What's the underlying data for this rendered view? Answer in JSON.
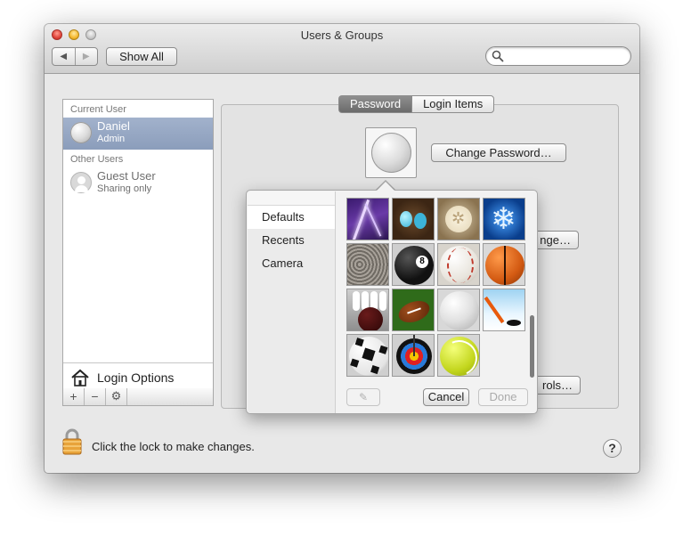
{
  "window": {
    "title": "Users & Groups"
  },
  "toolbar": {
    "show_all_label": "Show All",
    "search": {
      "placeholder": "",
      "value": ""
    }
  },
  "sidebar": {
    "current_user_header": "Current User",
    "current_user": {
      "name": "Daniel",
      "role": "Admin"
    },
    "other_users_header": "Other Users",
    "other_users": [
      {
        "name": "Guest User",
        "role": "Sharing only"
      }
    ],
    "login_options_label": "Login Options",
    "tools": {
      "add": "+",
      "remove": "−",
      "gear": "⚙"
    }
  },
  "main": {
    "tabs": [
      {
        "label": "Password",
        "active": true
      },
      {
        "label": "Login Items",
        "active": false
      }
    ],
    "change_password_label": "Change Password…",
    "obscured_button_partial": "nge…",
    "obscured_controls_partial": "rols…"
  },
  "picture_picker": {
    "categories": [
      {
        "label": "Defaults",
        "selected": true
      },
      {
        "label": "Recents",
        "selected": false
      },
      {
        "label": "Camera",
        "selected": false
      }
    ],
    "pictures": [
      "lightning",
      "bird-eggs",
      "sand-dollar",
      "snowflake",
      "zen",
      "8-ball",
      "baseball",
      "basketball",
      "bowling",
      "football",
      "golf-ball",
      "hockey",
      "soccer-ball",
      "target",
      "tennis-ball"
    ],
    "cancel_label": "Cancel",
    "done_label": "Done"
  },
  "footer": {
    "lock_text": "Click the lock to make changes.",
    "help_label": "?"
  }
}
